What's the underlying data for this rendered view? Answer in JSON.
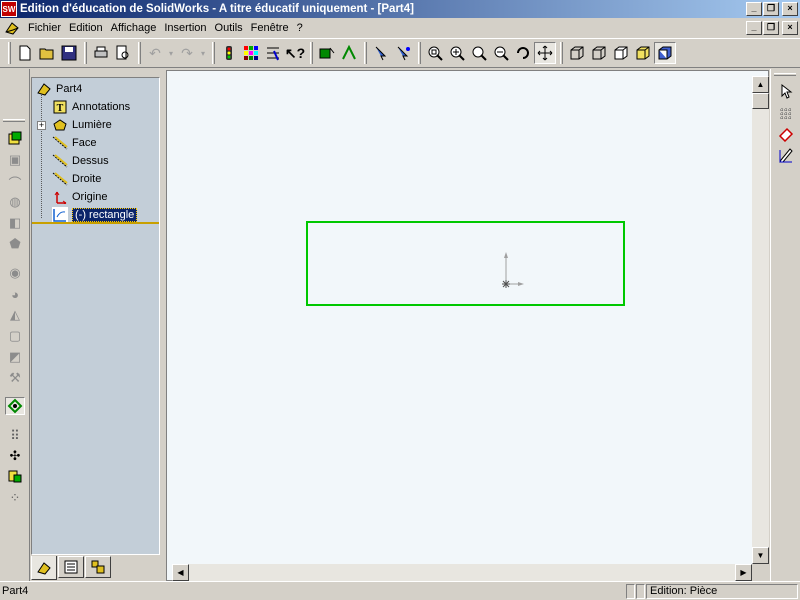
{
  "window": {
    "logo_text": "SW",
    "title": "Edition d'éducation de SolidWorks - A titre éducatif uniquement - [Part4]",
    "btn_min": "_",
    "btn_restore": "❐",
    "btn_close": "×"
  },
  "menu": {
    "items": [
      "Fichier",
      "Edition",
      "Affichage",
      "Insertion",
      "Outils",
      "Fenêtre",
      "?"
    ]
  },
  "toolbar": {
    "icons": [
      "new-icon",
      "open-icon",
      "save-icon",
      "print-icon",
      "print-preview-icon",
      "undo-icon",
      "redo-icon",
      "rebuild-icon",
      "color-icon",
      "options-icon",
      "help-icon",
      "sketch-icon",
      "smart-dimension-icon",
      "select-icon",
      "select-other-icon",
      "zoom-fit-icon",
      "zoom-in-icon",
      "zoom-area-icon",
      "zoom-out-icon",
      "rotate-icon",
      "pan-icon",
      "wireframe-icon",
      "hidden-lines-icon",
      "hidden-removed-icon",
      "shaded-edges-icon",
      "shaded-icon"
    ],
    "accent": "#0a246a"
  },
  "tree": {
    "root": "Part4",
    "nodes": [
      {
        "label": "Annotations",
        "icon": "annotations-icon"
      },
      {
        "label": "Lumière",
        "icon": "light-icon",
        "expandable": true
      },
      {
        "label": "Face",
        "icon": "plane-icon"
      },
      {
        "label": "Dessus",
        "icon": "plane-icon"
      },
      {
        "label": "Droite",
        "icon": "plane-icon"
      },
      {
        "label": "Origine",
        "icon": "origin-icon"
      },
      {
        "label": "(-) rectangle",
        "icon": "sketch-icon",
        "selected": true
      }
    ],
    "expander": "+",
    "tabs": [
      "feature-manager-tab",
      "property-manager-tab",
      "configuration-manager-tab"
    ]
  },
  "graphics": {
    "background": "#f2f7fa",
    "sketch_color": "#00c800"
  },
  "status": {
    "left": "Part4",
    "mode": "Edition: Pièce"
  }
}
